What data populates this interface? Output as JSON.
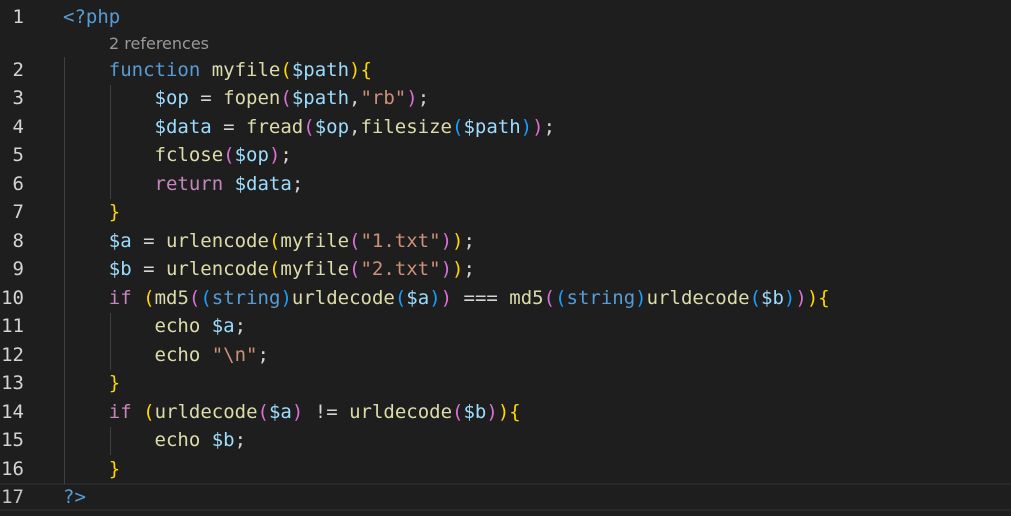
{
  "editor": {
    "codelens": "2 references",
    "lines": [
      {
        "n": "1",
        "tokens": [
          [
            "t-tag",
            "<?php"
          ]
        ]
      },
      {
        "n": "2",
        "tokens": [
          [
            "t-op",
            "    "
          ],
          [
            "t-kw",
            "function"
          ],
          [
            "t-op",
            " "
          ],
          [
            "t-fn",
            "myfile"
          ],
          [
            "b1",
            "("
          ],
          [
            "t-var",
            "$path"
          ],
          [
            "b1",
            ")"
          ],
          [
            "b1",
            "{"
          ]
        ]
      },
      {
        "n": "3",
        "tokens": [
          [
            "t-op",
            "        "
          ],
          [
            "t-var",
            "$op"
          ],
          [
            "t-op",
            " = "
          ],
          [
            "t-fn",
            "fopen"
          ],
          [
            "b2",
            "("
          ],
          [
            "t-var",
            "$path"
          ],
          [
            "t-op",
            ","
          ],
          [
            "t-str",
            "\"rb\""
          ],
          [
            "b2",
            ")"
          ],
          [
            "t-op",
            ";"
          ]
        ]
      },
      {
        "n": "4",
        "tokens": [
          [
            "t-op",
            "        "
          ],
          [
            "t-var",
            "$data"
          ],
          [
            "t-op",
            " = "
          ],
          [
            "t-fn",
            "fread"
          ],
          [
            "b2",
            "("
          ],
          [
            "t-var",
            "$op"
          ],
          [
            "t-op",
            ","
          ],
          [
            "t-fn",
            "filesize"
          ],
          [
            "b3",
            "("
          ],
          [
            "t-var",
            "$path"
          ],
          [
            "b3",
            ")"
          ],
          [
            "b2",
            ")"
          ],
          [
            "t-op",
            ";"
          ]
        ]
      },
      {
        "n": "5",
        "tokens": [
          [
            "t-op",
            "        "
          ],
          [
            "t-fn",
            "fclose"
          ],
          [
            "b2",
            "("
          ],
          [
            "t-var",
            "$op"
          ],
          [
            "b2",
            ")"
          ],
          [
            "t-op",
            ";"
          ]
        ]
      },
      {
        "n": "6",
        "tokens": [
          [
            "t-op",
            "        "
          ],
          [
            "t-ctrl",
            "return"
          ],
          [
            "t-op",
            " "
          ],
          [
            "t-var",
            "$data"
          ],
          [
            "t-op",
            ";"
          ]
        ]
      },
      {
        "n": "7",
        "tokens": [
          [
            "t-op",
            "    "
          ],
          [
            "b1",
            "}"
          ]
        ]
      },
      {
        "n": "8",
        "tokens": [
          [
            "t-op",
            "    "
          ],
          [
            "t-var",
            "$a"
          ],
          [
            "t-op",
            " = "
          ],
          [
            "t-fn",
            "urlencode"
          ],
          [
            "b1",
            "("
          ],
          [
            "t-fn",
            "myfile"
          ],
          [
            "b2",
            "("
          ],
          [
            "t-str",
            "\"1.txt\""
          ],
          [
            "b2",
            ")"
          ],
          [
            "b1",
            ")"
          ],
          [
            "t-op",
            ";"
          ]
        ]
      },
      {
        "n": "9",
        "tokens": [
          [
            "t-op",
            "    "
          ],
          [
            "t-var",
            "$b"
          ],
          [
            "t-op",
            " = "
          ],
          [
            "t-fn",
            "urlencode"
          ],
          [
            "b1",
            "("
          ],
          [
            "t-fn",
            "myfile"
          ],
          [
            "b2",
            "("
          ],
          [
            "t-str",
            "\"2.txt\""
          ],
          [
            "b2",
            ")"
          ],
          [
            "b1",
            ")"
          ],
          [
            "t-op",
            ";"
          ]
        ]
      },
      {
        "n": "10",
        "tokens": [
          [
            "t-op",
            "    "
          ],
          [
            "t-ctrl",
            "if"
          ],
          [
            "t-op",
            " "
          ],
          [
            "b1",
            "("
          ],
          [
            "t-fn",
            "md5"
          ],
          [
            "b2",
            "("
          ],
          [
            "b3",
            "("
          ],
          [
            "t-kw",
            "string"
          ],
          [
            "b3",
            ")"
          ],
          [
            "t-fn",
            "urldecode"
          ],
          [
            "b3",
            "("
          ],
          [
            "t-var",
            "$a"
          ],
          [
            "b3",
            ")"
          ],
          [
            "b2",
            ")"
          ],
          [
            "t-op",
            " === "
          ],
          [
            "t-fn",
            "md5"
          ],
          [
            "b2",
            "("
          ],
          [
            "b3",
            "("
          ],
          [
            "t-kw",
            "string"
          ],
          [
            "b3",
            ")"
          ],
          [
            "t-fn",
            "urldecode"
          ],
          [
            "b3",
            "("
          ],
          [
            "t-var",
            "$b"
          ],
          [
            "b3",
            ")"
          ],
          [
            "b2",
            ")"
          ],
          [
            "b1",
            ")"
          ],
          [
            "b1",
            "{"
          ]
        ]
      },
      {
        "n": "11",
        "tokens": [
          [
            "t-op",
            "        "
          ],
          [
            "t-fn",
            "echo"
          ],
          [
            "t-op",
            " "
          ],
          [
            "t-var",
            "$a"
          ],
          [
            "t-op",
            ";"
          ]
        ]
      },
      {
        "n": "12",
        "tokens": [
          [
            "t-op",
            "        "
          ],
          [
            "t-fn",
            "echo"
          ],
          [
            "t-op",
            " "
          ],
          [
            "t-str",
            "\"\\n\""
          ],
          [
            "t-op",
            ";"
          ]
        ]
      },
      {
        "n": "13",
        "tokens": [
          [
            "t-op",
            "    "
          ],
          [
            "b1",
            "}"
          ]
        ]
      },
      {
        "n": "14",
        "tokens": [
          [
            "t-op",
            "    "
          ],
          [
            "t-ctrl",
            "if"
          ],
          [
            "t-op",
            " "
          ],
          [
            "b1",
            "("
          ],
          [
            "t-fn",
            "urldecode"
          ],
          [
            "b2",
            "("
          ],
          [
            "t-var",
            "$a"
          ],
          [
            "b2",
            ")"
          ],
          [
            "t-op",
            " != "
          ],
          [
            "t-fn",
            "urldecode"
          ],
          [
            "b2",
            "("
          ],
          [
            "t-var",
            "$b"
          ],
          [
            "b2",
            ")"
          ],
          [
            "b1",
            ")"
          ],
          [
            "b1",
            "{"
          ]
        ]
      },
      {
        "n": "15",
        "tokens": [
          [
            "t-op",
            "        "
          ],
          [
            "t-fn",
            "echo"
          ],
          [
            "t-op",
            " "
          ],
          [
            "t-var",
            "$b"
          ],
          [
            "t-op",
            ";"
          ]
        ]
      },
      {
        "n": "16",
        "tokens": [
          [
            "t-op",
            "    "
          ],
          [
            "b1",
            "}"
          ]
        ]
      },
      {
        "n": "17",
        "tokens": [
          [
            "t-tag",
            "?>"
          ]
        ]
      }
    ]
  }
}
